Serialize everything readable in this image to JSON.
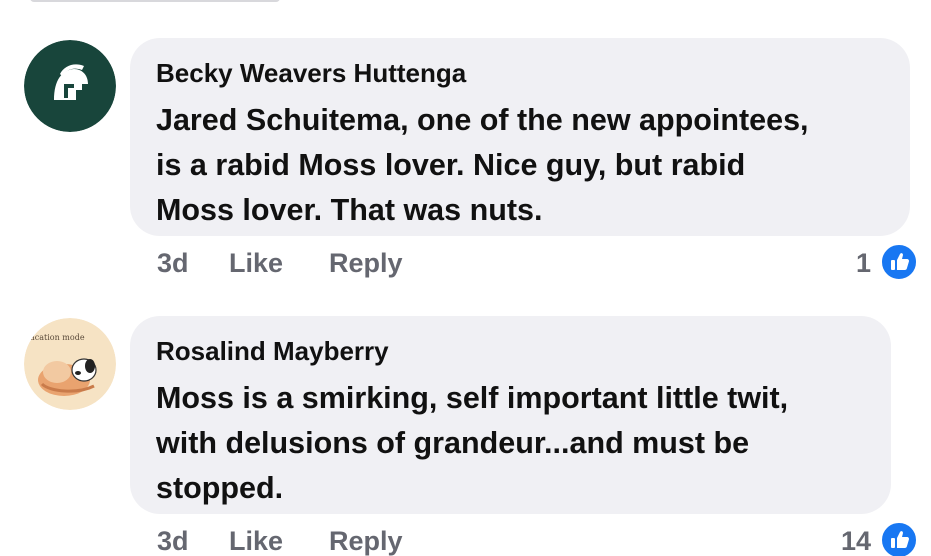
{
  "comments": [
    {
      "author": "Becky Weavers Huttenga",
      "text_lines": [
        "Jared Schuitema, one of the new appointees,",
        "is a rabid Moss lover. Nice guy, but rabid",
        "Moss lover. That was nuts."
      ],
      "time": "3d",
      "like_label": "Like",
      "reply_label": "Reply",
      "reaction_count": "1",
      "avatar": "spartan-helmet-logo",
      "avatar_color": "#18453b"
    },
    {
      "author": "Rosalind Mayberry",
      "text_lines": [
        "Moss is a smirking, self important little twit,",
        "with delusions of grandeur...and must be",
        "stopped."
      ],
      "time": "3d",
      "like_label": "Like",
      "reply_label": "Reply",
      "reaction_count": "14",
      "avatar": "vacation-mode-illustration",
      "avatar_text": "acation mode"
    }
  ],
  "colors": {
    "bubble": "#f0f0f4",
    "like_blue": "#1877f2",
    "meta_text": "#656770"
  }
}
